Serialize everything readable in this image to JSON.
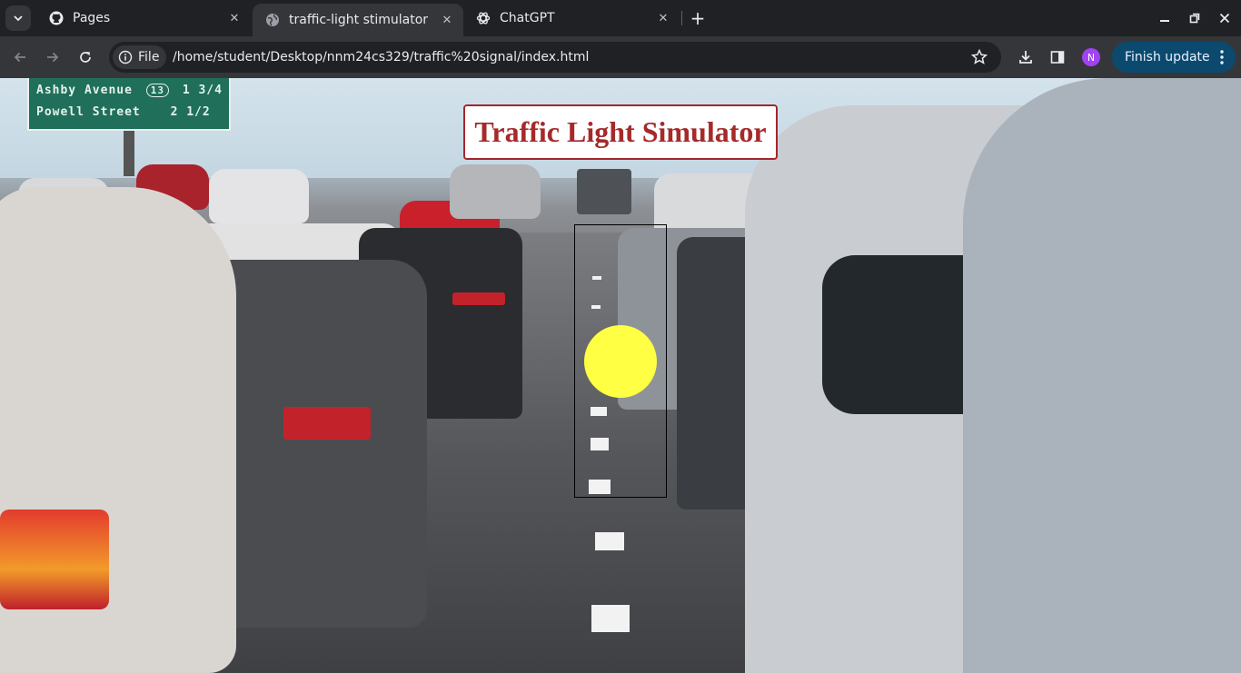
{
  "browser": {
    "tabs": [
      {
        "title": "Pages",
        "icon": "github-icon",
        "active": false
      },
      {
        "title": "traffic-light stimulator",
        "icon": "globe-icon",
        "active": true
      },
      {
        "title": "ChatGPT",
        "icon": "chatgpt-icon",
        "active": false
      }
    ],
    "new_tab_label": "+",
    "address": {
      "chip_label": "File",
      "url": "/home/student/Desktop/nnm24cs329/traffic%20signal/index.html"
    },
    "profile_initial": "N",
    "finish_update_label": "Finish update"
  },
  "page": {
    "title": "Traffic Light Simulator",
    "sign": {
      "line1": "Ashby Avenue",
      "line1_route": "13",
      "line1_distance": "1 3/4",
      "line2": "Powell Street",
      "line2_distance": "2 1/2"
    },
    "traffic_light": {
      "active_color": "yellow",
      "colors": {
        "yellow": "#ffff44"
      }
    }
  }
}
